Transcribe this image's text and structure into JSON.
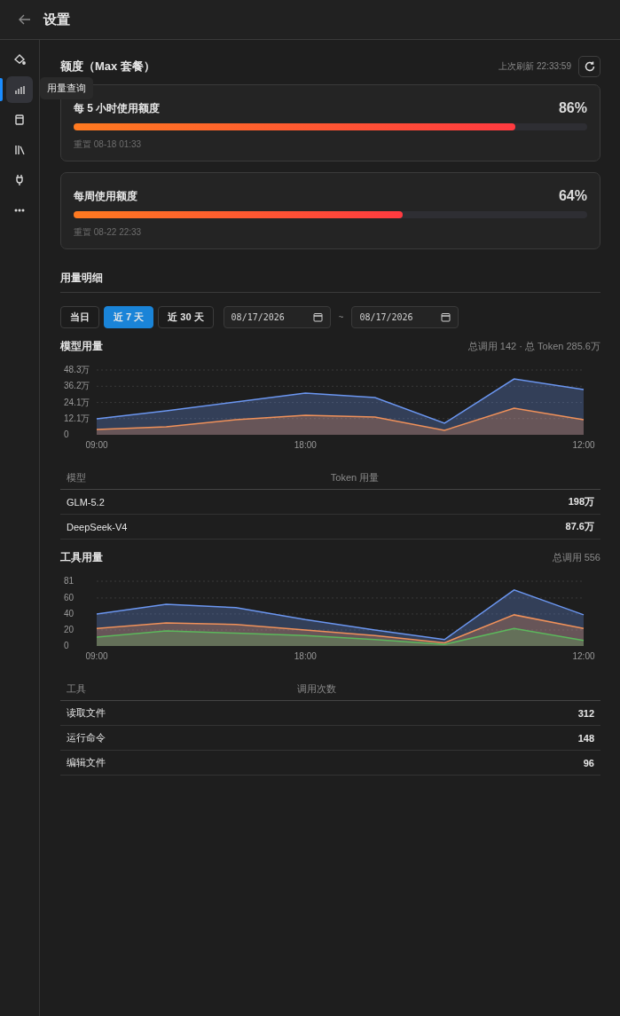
{
  "header": {
    "title": "设置"
  },
  "sidebar": {
    "items": [
      {
        "selected": false
      },
      {
        "selected": true,
        "tooltip": "用量查询"
      },
      {
        "selected": false
      },
      {
        "selected": false
      },
      {
        "selected": false
      },
      {
        "selected": false
      }
    ]
  },
  "quota": {
    "title": "额度（Max 套餐）",
    "refreshed": "上次刷新 22:33:59",
    "cards": [
      {
        "label": "每 5 小时使用额度",
        "percent": "86%",
        "level": 0.86,
        "reset": "重置 08-18 01:33"
      },
      {
        "label": "每周使用额度",
        "percent": "64%",
        "level": 0.64,
        "reset": "重置 08-22 22:33"
      }
    ]
  },
  "details": {
    "title": "用量明细",
    "ranges": [
      {
        "label": "当日",
        "selected": false
      },
      {
        "label": "近 7 天",
        "selected": true
      },
      {
        "label": "近 30 天",
        "selected": false
      }
    ],
    "date_from": "08/17/2026",
    "separator": "~",
    "date_to": "08/17/2026"
  },
  "model_usage": {
    "title": "模型用量",
    "summary": "总调用 142 · 总 Token 285.6万",
    "chart_data": {
      "type": "area",
      "grid": true,
      "categories": [
        "09:00",
        null,
        null,
        "18:00",
        null,
        null,
        null,
        "12:00"
      ],
      "ylim": [
        0,
        48.3
      ],
      "yticks": [
        {
          "value": 0,
          "label": "0"
        },
        {
          "value": 12.1,
          "label": "12.1万"
        },
        {
          "value": 24.1,
          "label": "24.1万"
        },
        {
          "value": 36.2,
          "label": "36.2万"
        },
        {
          "value": 48.3,
          "label": "48.3万"
        }
      ],
      "series": [
        {
          "color": "#6b96f0",
          "values": [
            11.9,
            17.9,
            24.5,
            31.1,
            27.8,
            8.6,
            41.7,
            33.7
          ]
        },
        {
          "color": "#f0915a",
          "values": [
            4.0,
            6.0,
            11.2,
            14.6,
            13.2,
            3.3,
            19.8,
            11.2
          ]
        }
      ]
    },
    "columns": [
      "模型",
      "Token 用量"
    ],
    "rows": [
      [
        "GLM-5.2",
        "198万"
      ],
      [
        "DeepSeek-V4",
        "87.6万"
      ]
    ]
  },
  "tool_usage": {
    "title": "工具用量",
    "summary": "总调用 556",
    "chart_data": {
      "type": "area",
      "grid": true,
      "categories": [
        "09:00",
        null,
        null,
        "18:00",
        null,
        null,
        null,
        "12:00"
      ],
      "ylim": [
        0,
        81
      ],
      "yticks": [
        0,
        20,
        40,
        60,
        81
      ],
      "series": [
        {
          "color": "#6b96f0",
          "values": [
            40,
            52,
            48,
            33,
            20,
            8,
            70,
            39
          ]
        },
        {
          "color": "#f0915a",
          "values": [
            22,
            29,
            27,
            20,
            13,
            4,
            39,
            22
          ]
        },
        {
          "color": "#5cb85c",
          "values": [
            11,
            19,
            16,
            13,
            8,
            2,
            22,
            7
          ]
        }
      ]
    },
    "columns": [
      "工具",
      "调用次数"
    ],
    "rows": [
      [
        "读取文件",
        "312"
      ],
      [
        "运行命令",
        "148"
      ],
      [
        "编辑文件",
        "96"
      ]
    ]
  }
}
